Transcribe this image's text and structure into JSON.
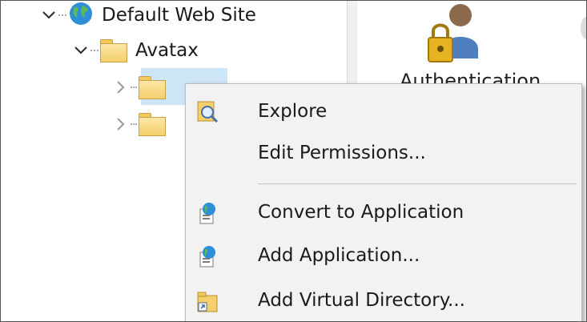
{
  "tree": {
    "nodes": [
      {
        "label": "Default Web Site",
        "expanded": true,
        "icon": "globe-icon"
      },
      {
        "label": "Avatax",
        "expanded": true,
        "icon": "folder-icon"
      },
      {
        "label": "",
        "expanded": false,
        "icon": "folder-icon",
        "selected": true
      },
      {
        "label": "",
        "expanded": false,
        "icon": "folder-icon"
      }
    ]
  },
  "right_panel": {
    "feature_label": "Authentication",
    "icon": "authentication-icon"
  },
  "context_menu": {
    "items": [
      {
        "label": "Explore",
        "icon": "explore-icon"
      },
      {
        "label": "Edit Permissions...",
        "icon": ""
      },
      {
        "label": "Convert to Application",
        "icon": "convert-application-icon"
      },
      {
        "label": "Add Application...",
        "icon": "add-application-icon"
      },
      {
        "label": "Add Virtual Directory...",
        "icon": "add-virtual-directory-icon"
      }
    ]
  }
}
